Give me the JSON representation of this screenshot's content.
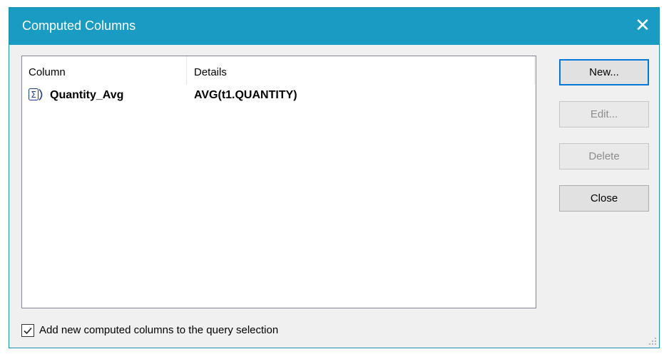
{
  "window": {
    "title": "Computed Columns",
    "close_glyph": "✕"
  },
  "list": {
    "columns": [
      "Column",
      "Details"
    ],
    "rows": [
      {
        "icon": "sigma-icon",
        "name": "Quantity_Avg",
        "details": "AVG(t1.QUANTITY)"
      }
    ]
  },
  "buttons": {
    "new": "New...",
    "edit": "Edit...",
    "delete": "Delete",
    "close": "Close"
  },
  "option": {
    "label": "Add new computed columns to the query selection",
    "checked": true
  },
  "colors": {
    "titlebar": "#1a9bc3",
    "accent": "#0078d7"
  }
}
